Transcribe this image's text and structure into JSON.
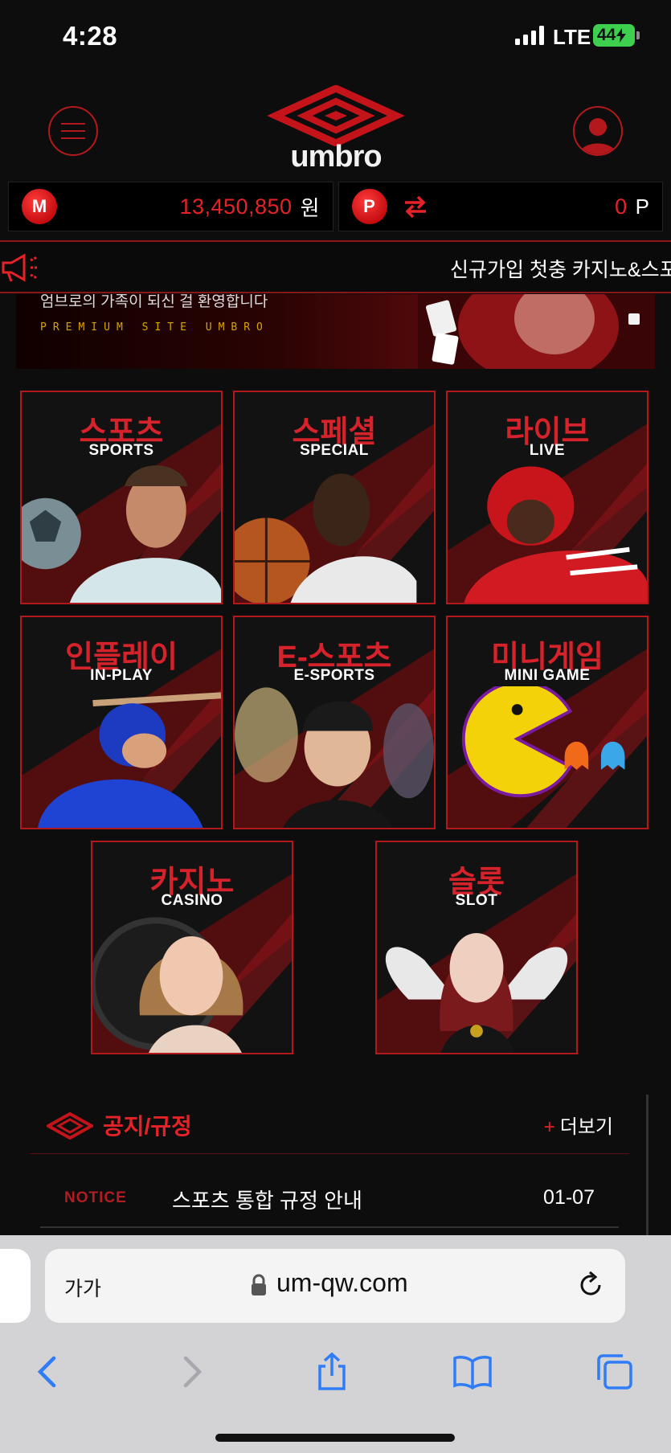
{
  "status_bar": {
    "time": "4:28",
    "network": "LTE",
    "battery": "44"
  },
  "header": {
    "brand": "umbro",
    "menu_icon": "hamburger-menu-icon",
    "user_icon": "user-profile-icon"
  },
  "balance": {
    "money_icon_letter": "M",
    "money_amount": "13,450,850",
    "money_unit": "원",
    "point_icon_letter": "P",
    "point_amount": "0",
    "point_unit": "P"
  },
  "marquee": {
    "text": "신규가입 첫충 카지노&스포츠"
  },
  "banner": {
    "line1": "엄브로의 가족이 되신 걸 환영합니다",
    "line2": "PREMIUM SITE UMBRO"
  },
  "games": [
    {
      "ko": "스포츠",
      "en": "SPORTS"
    },
    {
      "ko": "스페셜",
      "en": "SPECIAL"
    },
    {
      "ko": "라이브",
      "en": "LIVE"
    },
    {
      "ko": "인플레이",
      "en": "IN-PLAY"
    },
    {
      "ko": "E-스포츠",
      "en": "E-SPORTS"
    },
    {
      "ko": "미니게임",
      "en": "MINI GAME"
    },
    {
      "ko": "카지노",
      "en": "CASINO"
    },
    {
      "ko": "슬롯",
      "en": "SLOT"
    }
  ],
  "notice": {
    "title": "공지/규정",
    "more_plus": "+",
    "more_label": "더보기",
    "rows": [
      {
        "tag": "NOTICE",
        "subject": "스포츠 통합 규정 안내",
        "date": "01-07"
      }
    ]
  },
  "browser": {
    "text_size_label": "가가",
    "url": "um-qw.com"
  },
  "colors": {
    "accent": "#e52228",
    "border": "#b3191c",
    "background": "#0d0d0d"
  }
}
